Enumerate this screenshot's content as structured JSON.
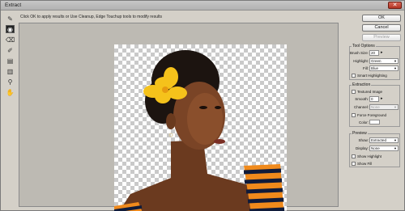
{
  "window": {
    "title": "Extract",
    "close_label": "✕"
  },
  "hint_text": "Click OK to apply results or Use Cleanup, Edge Touchup tools to modify results",
  "tools": [
    {
      "name": "edge-highlighter-icon",
      "glyph": "✎"
    },
    {
      "name": "fill-icon",
      "glyph": "◉"
    },
    {
      "name": "eraser-icon",
      "glyph": "⌫"
    },
    {
      "name": "eyedropper-icon",
      "glyph": "✐"
    },
    {
      "name": "cleanup-icon",
      "glyph": "▤"
    },
    {
      "name": "edge-touchup-icon",
      "glyph": "▥"
    },
    {
      "name": "zoom-icon",
      "glyph": "⚲"
    },
    {
      "name": "hand-icon",
      "glyph": "✋"
    }
  ],
  "buttons": {
    "ok": "OK",
    "cancel": "Cancel",
    "preview": "Preview"
  },
  "tool_options": {
    "title": "Tool Options",
    "brush_size_label": "Brush Size:",
    "brush_size_value": "20",
    "highlight_label": "Highlight:",
    "highlight_value": "Green",
    "fill_label": "Fill:",
    "fill_value": "Blue",
    "smart_highlighting_label": "Smart Highlighting"
  },
  "extraction": {
    "title": "Extraction",
    "textured_image_label": "Textured Image",
    "smooth_label": "Smooth:",
    "smooth_value": "0",
    "channel_label": "Channel:",
    "channel_value": "None",
    "force_foreground_label": "Force Foreground",
    "color_label": "Color:"
  },
  "preview": {
    "title": "Preview",
    "show_label": "Show:",
    "show_value": "Extracted",
    "display_label": "Display:",
    "display_value": "None",
    "show_highlight_label": "Show Highlight",
    "show_fill_label": "Show Fill"
  }
}
